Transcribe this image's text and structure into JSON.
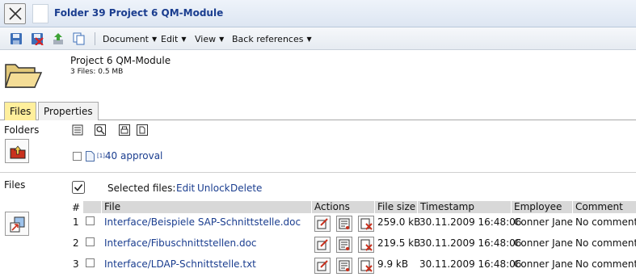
{
  "window": {
    "title": "Folder 39 Project 6 QM-Module"
  },
  "toolbar": {
    "menus": [
      "Document",
      "Edit",
      "View",
      "Back references"
    ]
  },
  "header": {
    "name": "Project 6 QM-Module",
    "info": "3 Files: 0.5 MB"
  },
  "tabs": [
    "Files",
    "Properties"
  ],
  "folders": {
    "label": "Folders",
    "items": [
      {
        "marker": "[1]",
        "name": "40 approval"
      }
    ]
  },
  "files": {
    "label": "Files",
    "selected_label": "Selected files:",
    "actions": [
      "Edit",
      "Unlock",
      "Delete"
    ],
    "columns": [
      "#",
      "File",
      "Actions",
      "File size",
      "Timestamp",
      "Employee",
      "Comment"
    ],
    "rows": [
      {
        "num": "1",
        "file": "Interface/Beispiele SAP-Schnittstelle.doc",
        "size": "259.0 kB",
        "timestamp": "30.11.2009 16:48:06",
        "employee": "Conner Jane",
        "comment": "No comment"
      },
      {
        "num": "2",
        "file": "Interface/Fibuschnittstellen.doc",
        "size": "219.5 kB",
        "timestamp": "30.11.2009 16:48:06",
        "employee": "Conner Jane",
        "comment": "No comment"
      },
      {
        "num": "3",
        "file": "Interface/LDAP-Schnittstelle.txt",
        "size": "9.9 kB",
        "timestamp": "30.11.2009 16:48:06",
        "employee": "Conner Jane",
        "comment": "No comment"
      }
    ]
  },
  "colors": {
    "title": "#1a3d8f",
    "link": "#1a3d8f",
    "active_tab": "#ffef9c",
    "header_cell": "#d8d8d8"
  }
}
